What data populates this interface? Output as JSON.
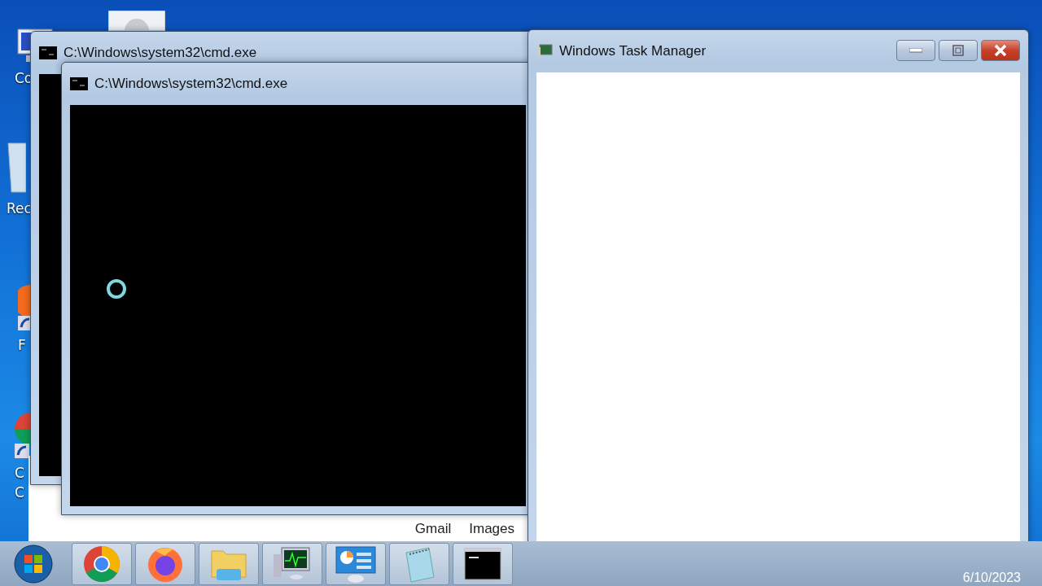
{
  "desktop": {
    "icons": [
      {
        "kind": "computer",
        "lines": [
          "Co"
        ]
      },
      {
        "kind": "settings"
      },
      {
        "kind": "recycle",
        "lines": [
          "Rec"
        ]
      },
      {
        "kind": "shortcut-orange",
        "lines": [
          "F"
        ]
      },
      {
        "kind": "shortcut-green",
        "lines": [
          "C",
          "C"
        ]
      }
    ]
  },
  "browser": {
    "links": [
      "Gmail",
      "Images"
    ]
  },
  "windows": [
    {
      "title": "C:\\Windows\\system32\\cmd.exe"
    },
    {
      "title": "C:\\Windows\\system32\\cmd.exe",
      "busy": true
    }
  ],
  "task_manager": {
    "title": "Windows Task Manager"
  },
  "taskbar": {
    "apps": [
      {
        "kind": "chrome"
      },
      {
        "kind": "firefox"
      },
      {
        "kind": "explorer"
      },
      {
        "kind": "taskmgr"
      },
      {
        "kind": "control"
      },
      {
        "kind": "notepad"
      },
      {
        "kind": "cmd"
      }
    ],
    "clock": "6/10/2023"
  }
}
